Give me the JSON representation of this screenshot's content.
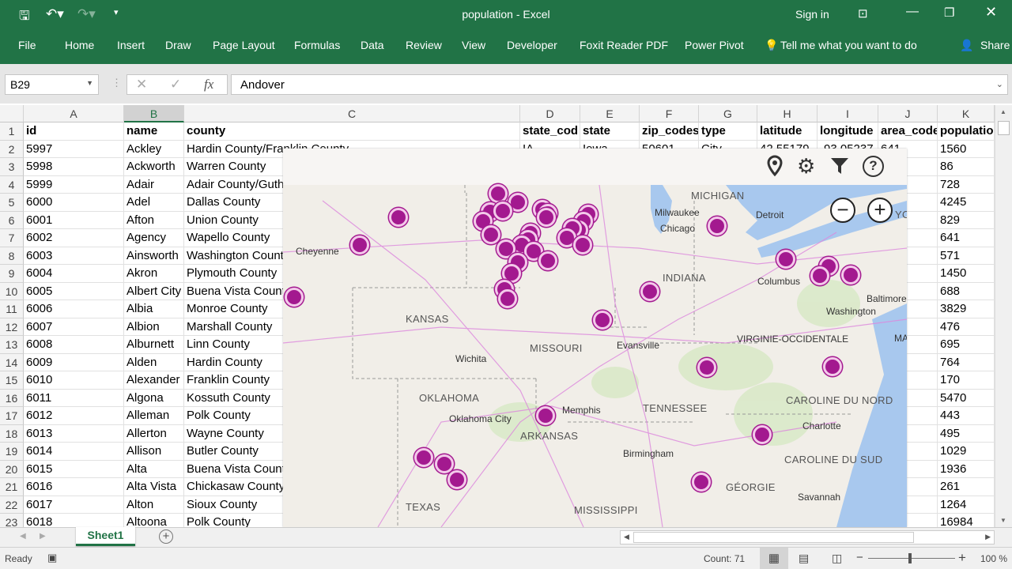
{
  "title_bar": {
    "title": "population  -  Excel",
    "sign_in": "Sign in",
    "icons": [
      "save-icon",
      "undo-icon",
      "redo-icon",
      "customize-icon",
      "ribbon-display-icon",
      "minimize-icon",
      "restore-icon",
      "close-icon"
    ]
  },
  "ribbon": {
    "tabs": [
      "File",
      "Home",
      "Insert",
      "Draw",
      "Page Layout",
      "Formulas",
      "Data",
      "Review",
      "View",
      "Developer",
      "Foxit Reader PDF",
      "Power Pivot"
    ],
    "tell_me": "Tell me what you want to do",
    "share": "Share"
  },
  "formula_bar": {
    "name_box": "B29",
    "fx": "fx",
    "value": "Andover"
  },
  "columns": [
    "A",
    "B",
    "C",
    "D",
    "E",
    "F",
    "G",
    "H",
    "I",
    "J",
    "K"
  ],
  "selected_column": "B",
  "header_row": [
    "id",
    "name",
    "county",
    "state_cod",
    "state",
    "zip_codes",
    "type",
    "latitude",
    "longitude",
    "area_code",
    "populatio"
  ],
  "row2_extra": [
    "IA",
    "Iowa",
    "50601",
    "City",
    "42.55179",
    "-93.05237",
    "641"
  ],
  "rows": [
    [
      "2",
      "5997",
      "Ackley",
      "Hardin County/Franklin County",
      "1560"
    ],
    [
      "3",
      "5998",
      "Ackworth",
      "Warren County",
      "86"
    ],
    [
      "4",
      "5999",
      "Adair",
      "Adair County/Guthrie County",
      "728"
    ],
    [
      "5",
      "6000",
      "Adel",
      "Dallas County",
      "4245"
    ],
    [
      "6",
      "6001",
      "Afton",
      "Union County",
      "829"
    ],
    [
      "7",
      "6002",
      "Agency",
      "Wapello County",
      "641"
    ],
    [
      "8",
      "6003",
      "Ainsworth",
      "Washington County",
      "571"
    ],
    [
      "9",
      "6004",
      "Akron",
      "Plymouth County",
      "1450"
    ],
    [
      "10",
      "6005",
      "Albert City",
      "Buena Vista County",
      "688"
    ],
    [
      "11",
      "6006",
      "Albia",
      "Monroe County",
      "3829"
    ],
    [
      "12",
      "6007",
      "Albion",
      "Marshall County",
      "476"
    ],
    [
      "13",
      "6008",
      "Alburnett",
      "Linn County",
      "695"
    ],
    [
      "14",
      "6009",
      "Alden",
      "Hardin County",
      "764"
    ],
    [
      "15",
      "6010",
      "Alexander",
      "Franklin County",
      "170"
    ],
    [
      "16",
      "6011",
      "Algona",
      "Kossuth County",
      "5470"
    ],
    [
      "17",
      "6012",
      "Alleman",
      "Polk County",
      "443"
    ],
    [
      "18",
      "6013",
      "Allerton",
      "Wayne County",
      "495"
    ],
    [
      "19",
      "6014",
      "Allison",
      "Butler County",
      "1029"
    ],
    [
      "20",
      "6015",
      "Alta",
      "Buena Vista County",
      "1936"
    ],
    [
      "21",
      "6016",
      "Alta Vista",
      "Chickasaw County",
      "261"
    ],
    [
      "22",
      "6017",
      "Alton",
      "Sioux County",
      "1264"
    ],
    [
      "23",
      "6018",
      "Altoona",
      "Polk County",
      "16984"
    ]
  ],
  "map": {
    "toolbar_icons": [
      "location-pin-icon",
      "gear-icon",
      "filter-icon",
      "help-icon"
    ],
    "zoom_out": "−",
    "zoom_in": "+",
    "pin_color": "#a3198f",
    "labels": [
      "MICHIGAN",
      "Milwaukee",
      "Chicago",
      "Detroit",
      "Cheyenne",
      "INDIANA",
      "Columbus",
      "Baltimore",
      "Washington",
      "KANSAS",
      "MISSOURI",
      "Evansville",
      "VIRGINIE-OCCIDENTALE",
      "Wichita",
      "OKLAHOMA",
      "Oklahoma City",
      "Memphis",
      "TENNESSEE",
      "CAROLINE DU NORD",
      "Charlotte",
      "ARKANSAS",
      "Birmingham",
      "CAROLINE DU SUD",
      "GÉORGIE",
      "Savannah",
      "TEXAS",
      "MISSISSIPPI",
      "YO",
      "MAR"
    ]
  },
  "sheet_tabs": {
    "active": "Sheet1",
    "add": "+"
  },
  "status_bar": {
    "ready": "Ready",
    "count": "Count: 71",
    "zoom": "100 %",
    "zoom_minus": "−",
    "zoom_plus": "+"
  }
}
